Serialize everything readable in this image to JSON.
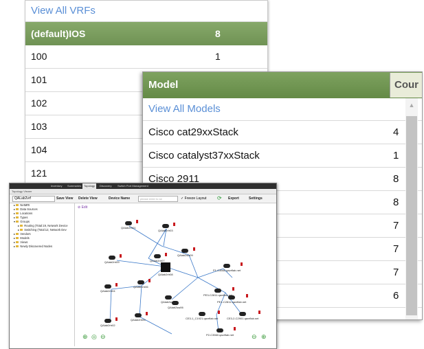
{
  "vrf_panel": {
    "view_all": "View All VRFs",
    "rows": [
      {
        "name": "(default)IOS",
        "count": "8",
        "highlight": true
      },
      {
        "name": "100",
        "count": "1"
      },
      {
        "name": "101",
        "count": ""
      },
      {
        "name": "102",
        "count": ""
      },
      {
        "name": "103",
        "count": ""
      },
      {
        "name": "104",
        "count": ""
      },
      {
        "name": "121",
        "count": ""
      }
    ]
  },
  "model_panel": {
    "col_model": "Model",
    "col_count": "Cour",
    "view_all": "View All Models",
    "rows": [
      {
        "name": "Cisco cat29xxStack",
        "count": "4"
      },
      {
        "name": "Cisco catalyst37xxStack",
        "count": "1"
      },
      {
        "name": "Cisco 2911",
        "count": "8"
      },
      {
        "name": "",
        "count": "8"
      },
      {
        "name": "",
        "count": "7"
      },
      {
        "name": "",
        "count": "7"
      },
      {
        "name": "",
        "count": "7"
      },
      {
        "name": "",
        "count": "6"
      }
    ]
  },
  "topology": {
    "tabs": [
      "Inventory",
      "Summaries",
      "Topology",
      "Discovery",
      "Switch Port Management"
    ],
    "active_tab": "Topology",
    "window_title": "Topology Viewer",
    "toolbar": {
      "view_select": "QALab2vrf",
      "save_view": "Save View",
      "delete_view": "Delete View",
      "device_name": "Device Name",
      "search_placeholder": "please enter to se",
      "freeze_layout": "Freeze Layout",
      "export": "Export",
      "settings": "Settings"
    },
    "tree": [
      "NetMRI",
      "Data Sources",
      "Locations",
      "Types",
      "Groups",
      "Routing (Total:19, Network Device",
      "Switching (Total:12, Network Dev",
      "Vendors",
      "Models",
      "Views",
      "Newly Discovered Nodes"
    ],
    "edit_label": "Edit",
    "nodes": [
      {
        "label": "QAlab2rtr01"
      },
      {
        "label": "QAlab2rtr03"
      },
      {
        "label": "QAlab2rtr07"
      },
      {
        "label": "QAlab2rtr09"
      },
      {
        "label": "QAlab2sw09"
      },
      {
        "label": "QAlab2rtr08"
      },
      {
        "label": "QAlab2rtr06"
      },
      {
        "label": "QAlab2rtr04"
      },
      {
        "label": "QAlab2rtr02"
      },
      {
        "label": "QAlab2rtr05"
      },
      {
        "label": "QAlab2sw04"
      },
      {
        "label": "QAlab2sw06"
      },
      {
        "label": "P1-C3560.qavrflab.net"
      },
      {
        "label": "PE3-C2811.qavrflab.net"
      },
      {
        "label": "PE1-C2811.qavrflab.net"
      },
      {
        "label": "CE3-1_C1921.qavrflab.net"
      },
      {
        "label": "CE3-2-C2901.qavrflab.net"
      },
      {
        "label": "P2-C3560.qavrflab.net"
      }
    ]
  }
}
